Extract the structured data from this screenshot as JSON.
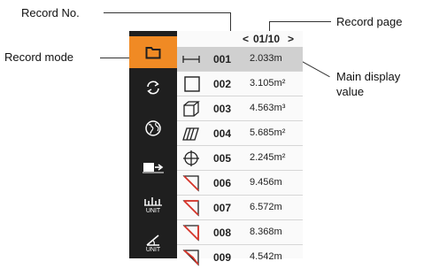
{
  "callouts": {
    "record_no": "Record No.",
    "record_mode": "Record mode",
    "record_page": "Record page",
    "main_display_value": "Main display value"
  },
  "pager": {
    "prev": "<",
    "page": "01/10",
    "next": ">"
  },
  "sidebar": {
    "items": [
      {
        "icon": "folder-icon",
        "active": true
      },
      {
        "icon": "refresh-icon"
      },
      {
        "icon": "globe-icon"
      },
      {
        "icon": "laser-reference-icon"
      },
      {
        "icon": "unit-scale-icon",
        "label": "UNIT"
      },
      {
        "icon": "angle-unit-icon",
        "label": "UNIT"
      }
    ]
  },
  "records": [
    {
      "no": "001",
      "value": "2.033m",
      "mode": "single-distance-icon",
      "selected": true
    },
    {
      "no": "002",
      "value": "3.105m²",
      "mode": "area-icon"
    },
    {
      "no": "003",
      "value": "4.563m³",
      "mode": "volume-icon"
    },
    {
      "no": "004",
      "value": "5.685m²",
      "mode": "wall-area-icon"
    },
    {
      "no": "005",
      "value": "2.245m²",
      "mode": "cross-area-icon"
    },
    {
      "no": "006",
      "value": "9.456m",
      "mode": "pythagoras-icon"
    },
    {
      "no": "007",
      "value": "6.572m",
      "mode": "pythagoras-icon"
    },
    {
      "no": "008",
      "value": "8.368m",
      "mode": "pythagoras-icon"
    },
    {
      "no": "009",
      "value": "4.542m",
      "mode": "pythagoras-icon"
    }
  ],
  "colors": {
    "accent": "#f08a24",
    "sidebar": "#1f1f1f",
    "highlight": "#d0d0d0",
    "mode_red": "#d9362b"
  }
}
